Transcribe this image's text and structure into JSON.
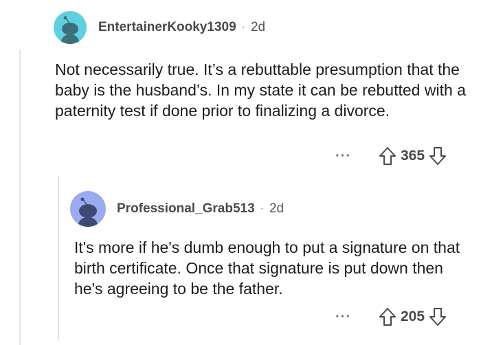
{
  "comments": [
    {
      "username": "EntertainerKooky1309",
      "separator": "·",
      "age": "2d",
      "avatar_color": "#5fd0df",
      "avatar_icon": "snoo-avatar-icon",
      "body": "Not necessarily true. It’s a rebuttable presumption that the baby is the husband’s. In my state it can be rebutted with a paternity test if done prior to finalizing a divorce.",
      "more_label": "···",
      "score": "365"
    },
    {
      "username": "Professional_Grab513",
      "separator": "·",
      "age": "2d",
      "avatar_color": "#9aabf2",
      "avatar_icon": "snoo-avatar-icon",
      "body": "It's more if he's dumb enough to put a signature on that birth certificate.  Once that signature is put down then he's agreeing to be the father.",
      "more_label": "···",
      "score": "205"
    }
  ],
  "colors": {
    "text": "#1c1c1c",
    "meta": "#4a4a4a",
    "thread_line": "#e4e4e4"
  },
  "icons": {
    "upvote": "arrow-up-outline-icon",
    "downvote": "arrow-down-outline-icon"
  }
}
